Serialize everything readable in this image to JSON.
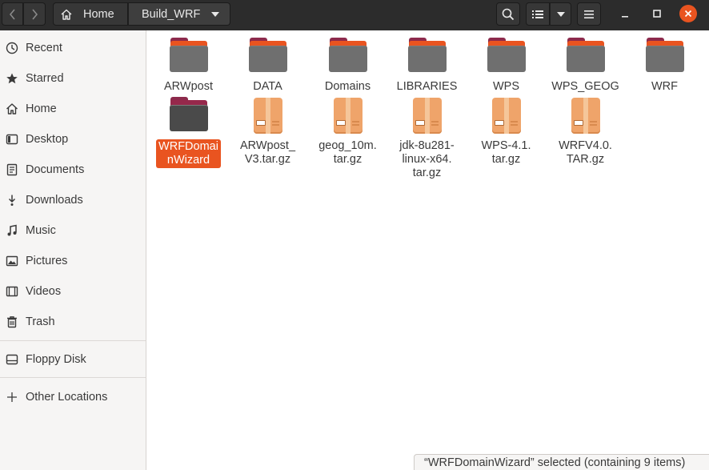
{
  "header": {
    "path": [
      {
        "label": "Home",
        "icon": "home-icon"
      },
      {
        "label": "Build_WRF",
        "icon": "chevron-down-icon"
      }
    ],
    "buttons": [
      "back-icon",
      "forward-icon",
      "search-icon",
      "list-view-icon",
      "chevron-down-icon",
      "hamburger-menu-icon"
    ],
    "window_controls": [
      "minimize-icon",
      "maximize-icon",
      "close-icon"
    ],
    "accent": "#e95420"
  },
  "sidebar": {
    "items": [
      {
        "label": "Recent",
        "icon": "clock-icon"
      },
      {
        "label": "Starred",
        "icon": "star-icon"
      },
      {
        "label": "Home",
        "icon": "home-icon"
      },
      {
        "label": "Desktop",
        "icon": "desktop-icon"
      },
      {
        "label": "Documents",
        "icon": "document-icon"
      },
      {
        "label": "Downloads",
        "icon": "download-icon"
      },
      {
        "label": "Music",
        "icon": "music-icon"
      },
      {
        "label": "Pictures",
        "icon": "picture-icon"
      },
      {
        "label": "Videos",
        "icon": "video-icon"
      },
      {
        "label": "Trash",
        "icon": "trash-icon"
      }
    ],
    "devices": [
      {
        "label": "Floppy Disk",
        "icon": "drive-icon"
      }
    ],
    "other": {
      "label": "Other Locations",
      "icon": "plus-icon"
    }
  },
  "files": [
    {
      "name": "ARWpost",
      "type": "folder"
    },
    {
      "name": "DATA",
      "type": "folder"
    },
    {
      "name": "Domains",
      "type": "folder"
    },
    {
      "name": "LIBRARIES",
      "type": "folder"
    },
    {
      "name": "WPS",
      "type": "folder"
    },
    {
      "name": "WPS_GEOG",
      "type": "folder"
    },
    {
      "name": "WRF",
      "type": "folder"
    },
    {
      "name": "WRFDomai\nnWizard",
      "type": "folder",
      "selected": true
    },
    {
      "name": "ARWpost_\nV3.tar.gz",
      "type": "archive"
    },
    {
      "name": "geog_10m.\ntar.gz",
      "type": "archive"
    },
    {
      "name": "jdk-8u281-\nlinux-x64.\ntar.gz",
      "type": "archive"
    },
    {
      "name": "WPS-4.1.\ntar.gz",
      "type": "archive"
    },
    {
      "name": "WRFV4.0.\nTAR.gz",
      "type": "archive"
    }
  ],
  "status": {
    "text": "“WRFDomainWizard” selected  (containing 9 items)"
  }
}
